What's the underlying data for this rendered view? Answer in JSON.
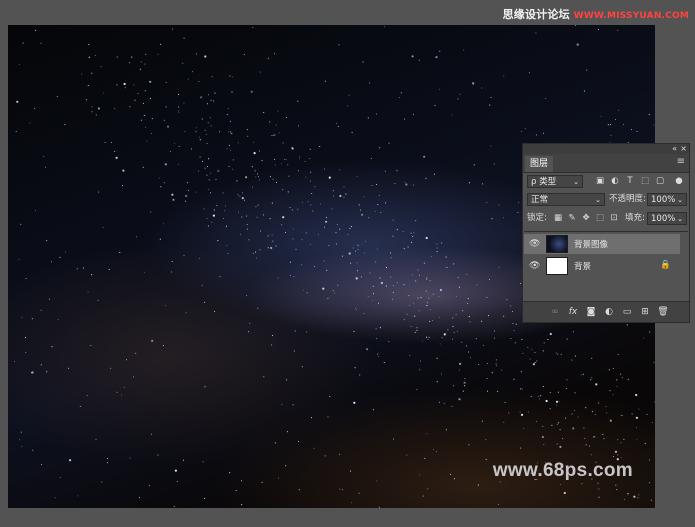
{
  "watermark_top": {
    "cn": "思缘设计论坛",
    "url": "WWW.MISSYUAN.COM"
  },
  "watermark_bottom": "www.68ps.com",
  "layers_panel": {
    "collapse_icon": "«",
    "close_icon": "×",
    "tab_label": "图层",
    "menu_icon": "≡",
    "filter_kind": "类型",
    "filter_icons": [
      "image-filter-icon",
      "adjustment-filter-icon",
      "type-filter-icon",
      "shape-filter-icon",
      "smartobject-filter-icon",
      "filter-toggle-icon"
    ],
    "blend_mode": "正常",
    "opacity_label": "不透明度:",
    "opacity_value": "100%",
    "lock_label": "锁定:",
    "fill_label": "填充:",
    "fill_value": "100%",
    "layers": [
      {
        "name": "背景图像",
        "visible": true,
        "selected": true,
        "thumbnail": "starry-night",
        "locked": false
      },
      {
        "name": "背景",
        "visible": true,
        "selected": false,
        "thumbnail": "white",
        "locked": true
      }
    ],
    "bottom_icons": [
      "link-icon",
      "fx-icon",
      "mask-icon",
      "adjustment-icon",
      "folder-icon",
      "new-layer-icon",
      "trash-icon"
    ]
  },
  "glyphs": {
    "eye": "👁",
    "caret": "⌄",
    "lock": "🔒",
    "search": "ρ",
    "fx": "fx",
    "type": "T"
  }
}
